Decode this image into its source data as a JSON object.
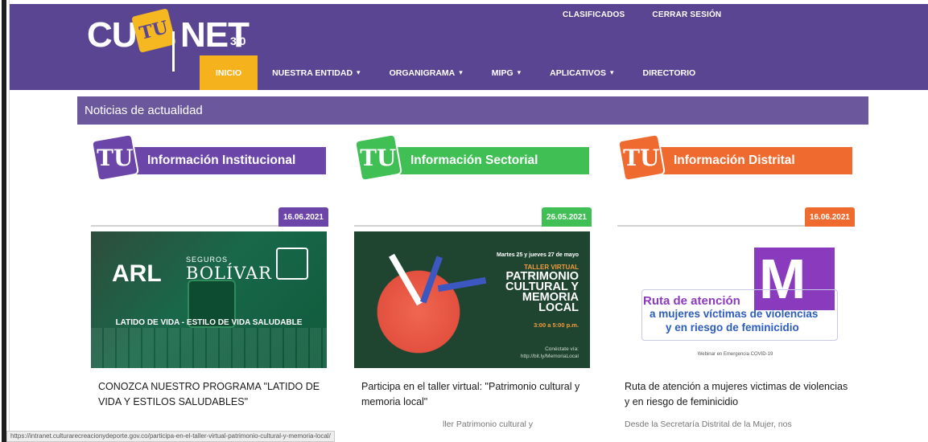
{
  "header": {
    "logo": {
      "part1": "CUL",
      "badge": "TU",
      "part2": "NET",
      "version": "3.0"
    },
    "top_links": [
      "CLASIFICADOS",
      "CERRAR SESIÓN"
    ],
    "nav": [
      {
        "label": "INICIO",
        "active": true,
        "dropdown": false
      },
      {
        "label": "NUESTRA ENTIDAD",
        "active": false,
        "dropdown": true
      },
      {
        "label": "ORGANIGRAMA",
        "active": false,
        "dropdown": true
      },
      {
        "label": "MIPG",
        "active": false,
        "dropdown": true
      },
      {
        "label": "APLICATIVOS",
        "active": false,
        "dropdown": true
      },
      {
        "label": "DIRECTORIO",
        "active": false,
        "dropdown": false
      }
    ],
    "colors": {
      "header_bg": "#5a4592",
      "active_tab": "#f6b21d"
    }
  },
  "section": {
    "title": "Noticias de actualidad"
  },
  "columns": [
    {
      "category": "Información Institucional",
      "badge": "TU",
      "color": "#6b45a8",
      "date": "16.06.2021",
      "image": {
        "arl": "ARL",
        "seguros": "SEGUROS",
        "bolivar": "BOLÍVAR",
        "tagline": "LATIDO DE VIDA - ESTILO DE VIDA SALUDABLE"
      },
      "title": "CONOZCA NUESTRO PROGRAMA \"LATIDO DE VIDA Y ESTILOS SALUDABLES\"",
      "excerpt": ""
    },
    {
      "category": "Información Sectorial",
      "badge": "TU",
      "color": "#3fbf54",
      "date": "26.05.2021",
      "image": {
        "dates": "Martes 25 y jueves 27 de mayo",
        "kind": "TALLER VIRTUAL",
        "headline": "PATRIMONIO CULTURAL Y MEMORIA LOCAL",
        "hours": "3:00 a 5:00 p.m.",
        "connect": "Conéctate vía:",
        "link": "http://bit.ly/MemoriaLocal"
      },
      "title": "Participa en el taller virtual: \"Patrimonio cultural y memoria local\"",
      "excerpt": "ller Patrimonio cultural y"
    },
    {
      "category": "Información Distrital",
      "badge": "TU",
      "color": "#ef6a2e",
      "date": "16.06.2021",
      "image": {
        "letter": "M",
        "line1": "Ruta de atención",
        "line2": "a mujeres víctimas de violencias",
        "line3": "y en riesgo de feminicidio",
        "footer": "Webinar en Emergencia COVID-19"
      },
      "title": "Ruta de atención a mujeres victimas de violencias y en riesgo de feminicidio",
      "excerpt": "Desde la Secretaría Distrital de la Mujer, nos"
    }
  ],
  "status_bar": {
    "url": "https://intranet.culturarecreacionydeporte.gov.co/participa-en-el-taller-virtual-patrimonio-cultural-y-memoria-local/"
  }
}
